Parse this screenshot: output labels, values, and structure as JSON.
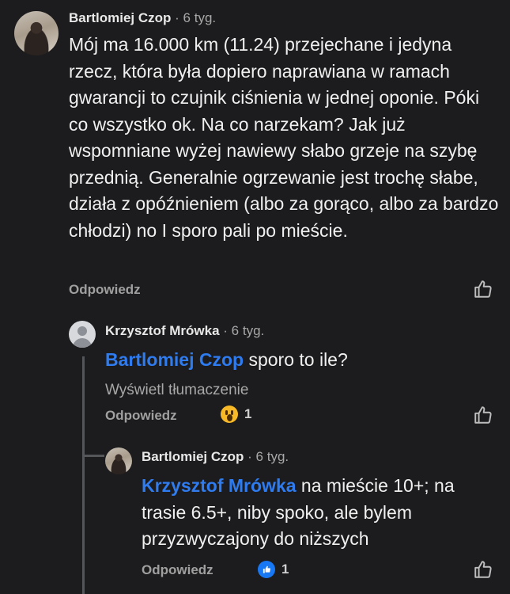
{
  "comments": [
    {
      "author": "Bartlomiej Czop",
      "time": "6 tyg.",
      "text": "Mój ma 16.000 km (11.24) przejechane i jedyna rzecz, która była dopiero naprawiana w ramach gwarancji to czujnik ciśnienia w jednej oponie. Póki co wszystko ok. Na co narzekam? Jak już wspomniane wyżej nawiewy słabo grzeje na szybę przednią. Generalnie ogrzewanie jest trochę słabe, działa z opóźnieniem (albo za gorąco, albo za bardzo chłodzi) no I sporo pali po mieście.",
      "reply_label": "Odpowiedz"
    },
    {
      "author": "Krzysztof Mrówka",
      "time": "6 tyg.",
      "mention": "Bartlomiej Czop",
      "text": " sporo to ile?",
      "translate_label": "Wyświetl tłumaczenie",
      "reply_label": "Odpowiedz",
      "reaction_count": "1"
    },
    {
      "author": "Bartlomiej Czop",
      "time": "6 tyg.",
      "mention": "Krzysztof Mrówka",
      "text": " na mieście 10+; na trasie 6.5+, niby spoko, ale bylem przyzwyczajony do niższych",
      "reply_label": "Odpowiedz",
      "reaction_count": "1"
    }
  ],
  "separator": "·",
  "colors": {
    "background": "#1c1c1e",
    "mention": "#2e7cf0",
    "wow_reaction": "#f7b928",
    "like_reaction": "#1877f2"
  }
}
